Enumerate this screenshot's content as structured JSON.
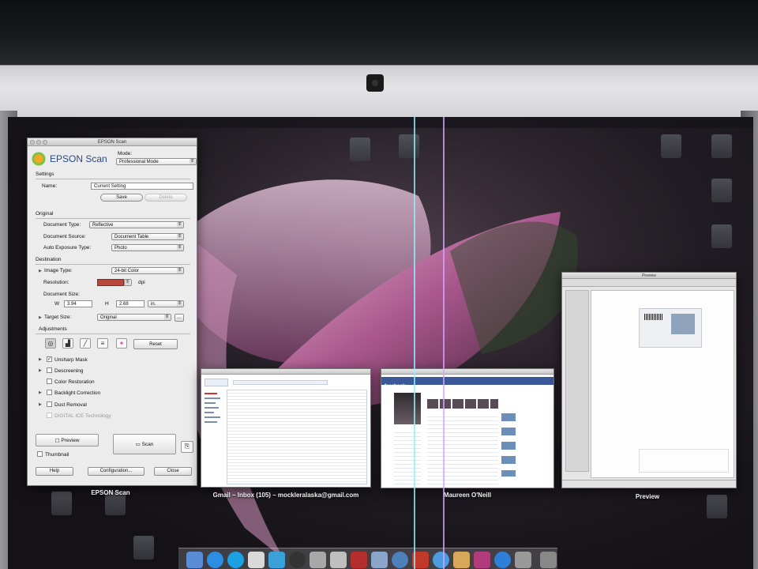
{
  "epson": {
    "window_title": "EPSON Scan",
    "brand": "EPSON Scan",
    "mode_label": "Mode:",
    "mode_value": "Professional Mode",
    "settings_label": "Settings",
    "name_label": "Name:",
    "name_value": "Current Setting",
    "save_label": "Save",
    "delete_label": "Delete",
    "original_label": "Original",
    "document_type_label": "Document Type:",
    "document_type_value": "Reflective",
    "document_source_label": "Document Source:",
    "document_source_value": "Document Table",
    "auto_exposure_label": "Auto Exposure Type:",
    "auto_exposure_value": "Photo",
    "destination_label": "Destination",
    "image_type_label": "Image Type:",
    "image_type_value": "24-bit Color",
    "resolution_label": "Resolution:",
    "resolution_unit": "dpi",
    "document_size_label": "Document Size:",
    "w_label": "W",
    "w_value": "3.94",
    "h_label": "H",
    "h_value": "2.68",
    "unit_value": "in.",
    "target_size_label": "Target Size:",
    "target_size_value": "Original",
    "adjustments_label": "Adjustments",
    "reset_label": "Reset",
    "unsharp_mask_label": "Unsharp Mask",
    "unsharp_mask_checked": "✓",
    "descreening_label": "Descreening",
    "color_restoration_label": "Color Restoration",
    "backlight_correction_label": "Backlight Correction",
    "dust_removal_label": "Dust Removal",
    "digital_ice_label": "DIGITAL ICE Technology",
    "preview_label": "Preview",
    "scan_label": "Scan",
    "thumbnail_label": "Thumbnail",
    "help_label": "Help",
    "configuration_label": "Configuration...",
    "close_label": "Close",
    "caption": "EPSON Scan"
  },
  "gmail": {
    "caption": "Gmail – Inbox (105) – mockleralaska@gmail.com"
  },
  "facebook": {
    "caption": "Maureen O'Neill",
    "logo": "facebook"
  },
  "preview": {
    "caption": "Preview",
    "window_title": "Preview"
  },
  "colors": {
    "epson_blue": "#2a4a86",
    "resolution_field": "#b5473c",
    "facebook_blue": "#3b5998"
  }
}
